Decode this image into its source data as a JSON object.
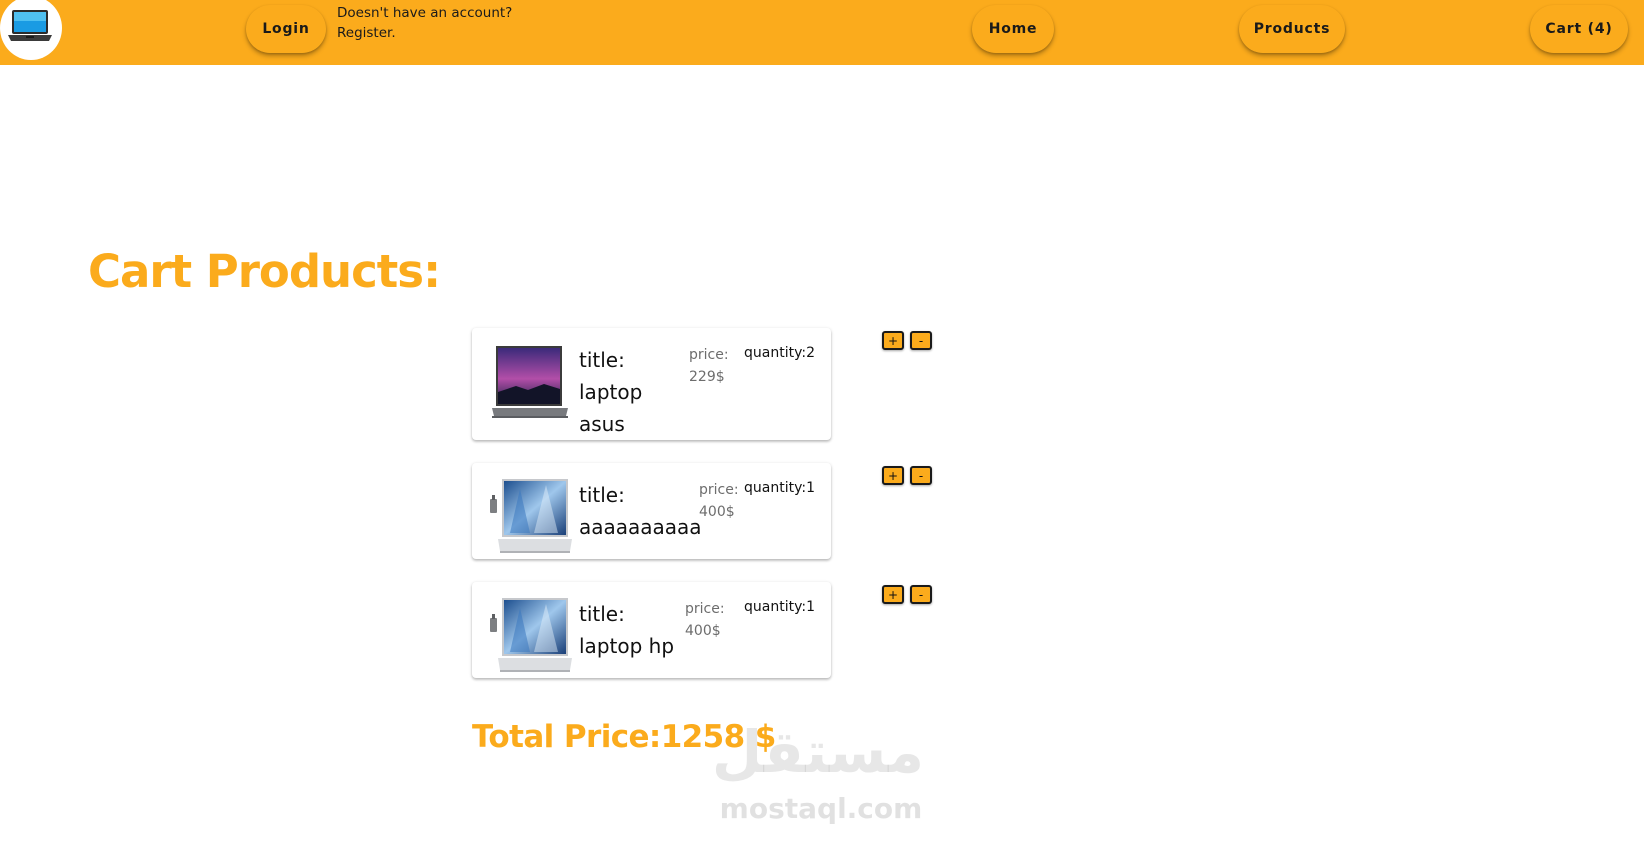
{
  "header": {
    "logo_icon": "laptop-icon",
    "login_label": "Login",
    "register_line1": "Doesn't have an account?",
    "register_line2": "Register.",
    "nav": {
      "home_label": "Home",
      "products_label": "Products",
      "cart_label": "Cart (4)"
    }
  },
  "main": {
    "heading": "Cart Products:",
    "items": [
      {
        "title_prefix": "title:",
        "title_words": [
          "laptop",
          "asus"
        ],
        "price_label": "price:",
        "price_value": "229$",
        "quantity": "quantity:2",
        "image_icon": "laptop-asus-image",
        "plus_label": "+",
        "minus_label": "-"
      },
      {
        "title_prefix": "title:",
        "title_words": [
          "aaaaaaaaaa"
        ],
        "price_label": "price:",
        "price_value": "400$",
        "quantity": "quantity:1",
        "image_icon": "laptop-hp-image",
        "plus_label": "+",
        "minus_label": "-"
      },
      {
        "title_prefix": "title:",
        "title_words": [
          "laptop hp"
        ],
        "price_label": "price:",
        "price_value": "400$",
        "quantity": "quantity:1",
        "image_icon": "laptop-hp-image",
        "plus_label": "+",
        "minus_label": "-"
      }
    ],
    "total": "Total Price:1258 $"
  },
  "watermark": {
    "arabic": "مستقل",
    "latin": "mostaql.com"
  },
  "colors": {
    "accent": "#fbab1c",
    "white": "#ffffff",
    "text": "#111111",
    "muted": "#6d6d6d"
  }
}
